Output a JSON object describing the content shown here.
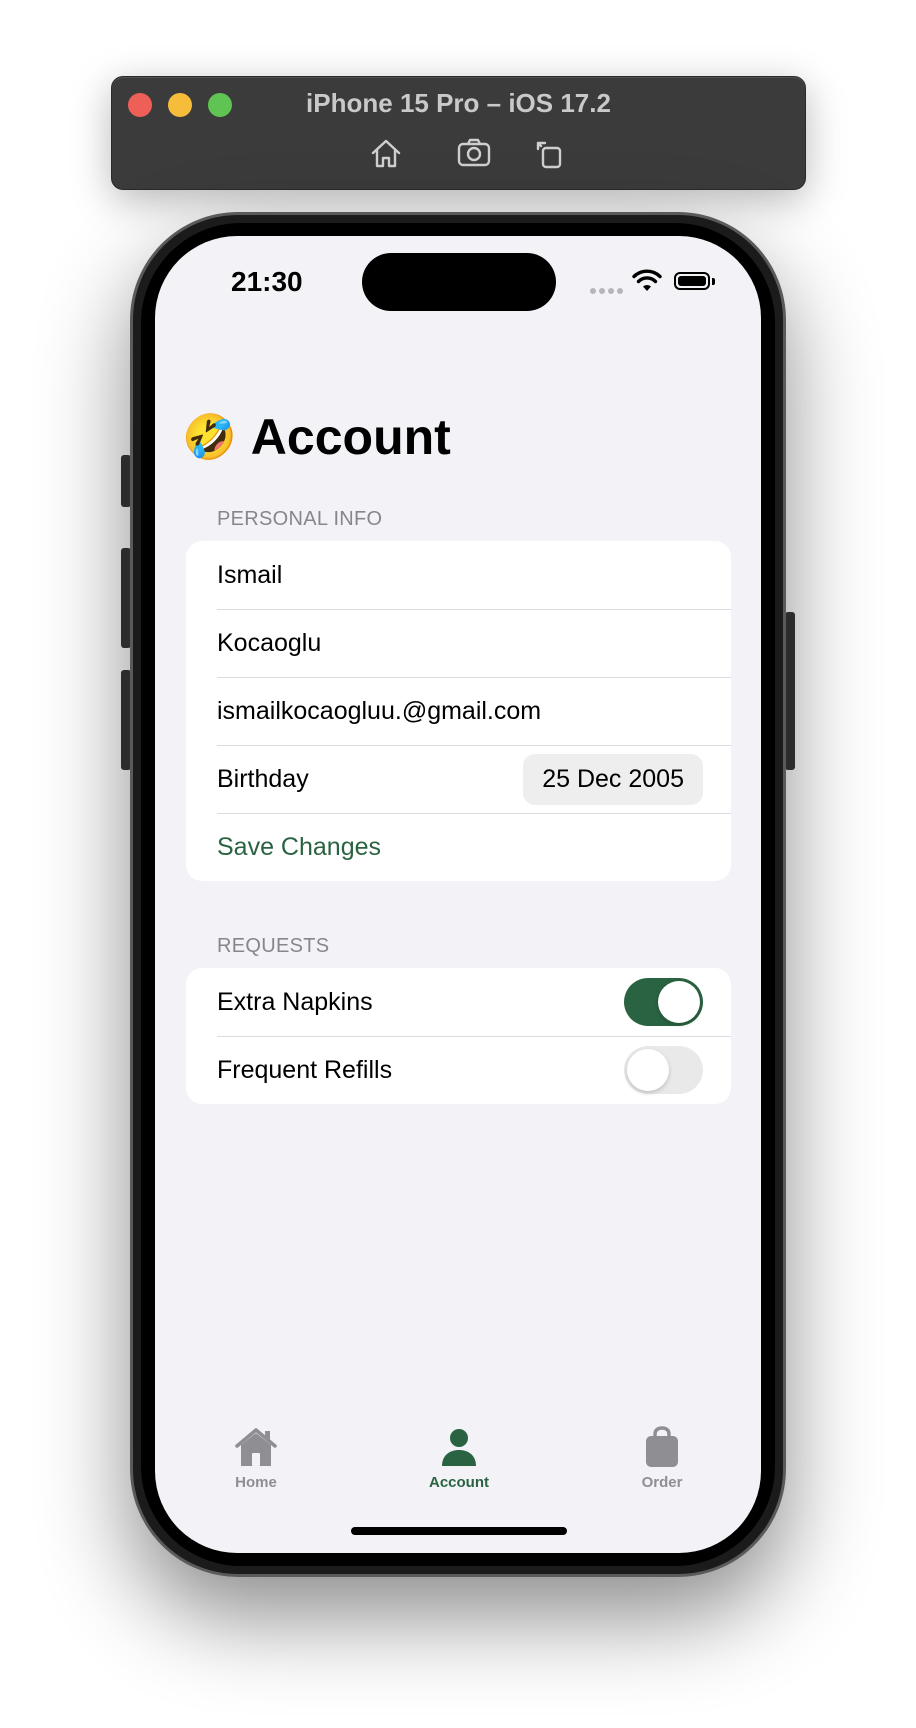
{
  "simulator": {
    "title": "iPhone 15 Pro – iOS 17.2",
    "tools": [
      "home-icon",
      "screenshot-icon",
      "rotate-icon"
    ]
  },
  "status_bar": {
    "time": "21:30",
    "icons": [
      "cellular-dots-icon",
      "wifi-icon",
      "battery-icon"
    ]
  },
  "page": {
    "emoji": "🤣",
    "title": "Account"
  },
  "personal_info": {
    "header": "PERSONAL INFO",
    "first_name": "Ismail",
    "last_name": "Kocaoglu",
    "email": "ismailkocaogluu.@gmail.com",
    "birthday_label": "Birthday",
    "birthday_value": "25 Dec 2005",
    "save_label": "Save Changes"
  },
  "requests": {
    "header": "REQUESTS",
    "items": [
      {
        "label": "Extra Napkins",
        "on": true
      },
      {
        "label": "Frequent Refills",
        "on": false
      }
    ]
  },
  "tabs": [
    {
      "label": "Home",
      "icon": "house-icon",
      "active": false
    },
    {
      "label": "Account",
      "icon": "person-icon",
      "active": true
    },
    {
      "label": "Order",
      "icon": "bag-icon",
      "active": false
    }
  ],
  "colors": {
    "accent": "#2a6341",
    "background": "#f2f2f7",
    "secondary_text": "#86868b"
  }
}
